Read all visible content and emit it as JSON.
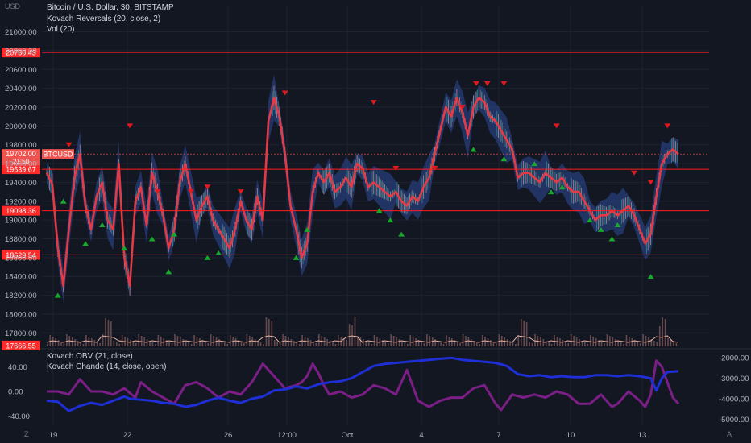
{
  "chart_data": {
    "type": "line",
    "left_axis_unit": "USD",
    "legend": {
      "symbol_line": "Bitcoin / U.S. Dollar, 30, BITSTAMP",
      "indicator_1": "Kovach Reversals (20, close, 2)",
      "indicator_2": "Vol (20)",
      "osc_1": "Kovach OBV (21, close)",
      "osc_2": "Kovach Chande (14, close, open)"
    },
    "x_axis": {
      "tick_labels": [
        "19",
        "22",
        "26",
        "12:00",
        "Oct",
        "4",
        "7",
        "10",
        "13"
      ],
      "corner_left": "Z",
      "corner_right": "A"
    },
    "price_axis": {
      "ticks": [
        21000,
        20800,
        20600,
        20400,
        20200,
        20000,
        19800,
        19600,
        19400,
        19200,
        19000,
        18800,
        18600,
        18400,
        18200,
        18000,
        17800
      ],
      "tick_labels": [
        "21000.00",
        "20800.00",
        "20600.00",
        "20400.00",
        "20200.00",
        "20000.00",
        "19800.00",
        "19600.00",
        "19400.00",
        "19200.00",
        "19000.00",
        "18800.00",
        "18600.00",
        "18400.00",
        "18200.00",
        "18000.00",
        "17800.00"
      ],
      "ylim": [
        17640,
        21270
      ]
    },
    "horizontal_levels": [
      {
        "value": 20780.43,
        "label": "20780.43"
      },
      {
        "value": 19539.67,
        "label": "19539.67"
      },
      {
        "value": 19098.36,
        "label": "19098.36"
      },
      {
        "value": 18629.54,
        "label": "18629.54"
      }
    ],
    "bottom_level": {
      "value": 17666.55,
      "label": "17666.55"
    },
    "last_price": {
      "value": 19702.0,
      "label": "19702.00",
      "ticker": "BTCUSD",
      "countdown": "21:50"
    },
    "price_path": [
      [
        0,
        19500
      ],
      [
        2,
        19380
      ],
      [
        4,
        18700
      ],
      [
        6,
        18300
      ],
      [
        8,
        18900
      ],
      [
        10,
        19450
      ],
      [
        12,
        19700
      ],
      [
        14,
        19150
      ],
      [
        16,
        18900
      ],
      [
        18,
        19250
      ],
      [
        20,
        19400
      ],
      [
        22,
        19000
      ],
      [
        24,
        18900
      ],
      [
        26,
        19600
      ],
      [
        28,
        18600
      ],
      [
        30,
        18300
      ],
      [
        32,
        19200
      ],
      [
        34,
        19350
      ],
      [
        36,
        18950
      ],
      [
        38,
        19500
      ],
      [
        40,
        19300
      ],
      [
        42,
        19050
      ],
      [
        44,
        18700
      ],
      [
        46,
        18900
      ],
      [
        48,
        19400
      ],
      [
        50,
        19600
      ],
      [
        52,
        19300
      ],
      [
        54,
        19000
      ],
      [
        56,
        19150
      ],
      [
        58,
        19250
      ],
      [
        60,
        19000
      ],
      [
        62,
        18900
      ],
      [
        64,
        18800
      ],
      [
        66,
        18700
      ],
      [
        68,
        18900
      ],
      [
        70,
        19200
      ],
      [
        72,
        19000
      ],
      [
        74,
        18900
      ],
      [
        76,
        19250
      ],
      [
        78,
        19000
      ],
      [
        80,
        20050
      ],
      [
        82,
        20300
      ],
      [
        84,
        20100
      ],
      [
        86,
        19700
      ],
      [
        88,
        19150
      ],
      [
        90,
        18900
      ],
      [
        92,
        18600
      ],
      [
        94,
        18750
      ],
      [
        96,
        19300
      ],
      [
        98,
        19500
      ],
      [
        100,
        19400
      ],
      [
        102,
        19500
      ],
      [
        104,
        19300
      ],
      [
        106,
        19350
      ],
      [
        108,
        19450
      ],
      [
        110,
        19350
      ],
      [
        112,
        19600
      ],
      [
        114,
        19550
      ],
      [
        116,
        19350
      ],
      [
        118,
        19400
      ],
      [
        120,
        19350
      ],
      [
        122,
        19300
      ],
      [
        124,
        19250
      ],
      [
        126,
        19300
      ],
      [
        128,
        19200
      ],
      [
        130,
        19150
      ],
      [
        132,
        19250
      ],
      [
        134,
        19200
      ],
      [
        136,
        19350
      ],
      [
        138,
        19450
      ],
      [
        140,
        19700
      ],
      [
        142,
        19950
      ],
      [
        144,
        20200
      ],
      [
        146,
        20100
      ],
      [
        148,
        20300
      ],
      [
        150,
        20150
      ],
      [
        152,
        19900
      ],
      [
        154,
        20200
      ],
      [
        156,
        20300
      ],
      [
        158,
        20250
      ],
      [
        160,
        20100
      ],
      [
        162,
        20050
      ],
      [
        164,
        19950
      ],
      [
        166,
        19850
      ],
      [
        168,
        19750
      ],
      [
        170,
        19450
      ],
      [
        172,
        19500
      ],
      [
        174,
        19500
      ],
      [
        176,
        19450
      ],
      [
        178,
        19400
      ],
      [
        180,
        19500
      ],
      [
        182,
        19450
      ],
      [
        184,
        19400
      ],
      [
        186,
        19450
      ],
      [
        188,
        19350
      ],
      [
        190,
        19300
      ],
      [
        192,
        19300
      ],
      [
        194,
        19200
      ],
      [
        196,
        19100
      ],
      [
        198,
        19000
      ],
      [
        200,
        19050
      ],
      [
        202,
        19050
      ],
      [
        204,
        19100
      ],
      [
        206,
        19050
      ],
      [
        208,
        19100
      ],
      [
        210,
        19150
      ],
      [
        212,
        19050
      ],
      [
        214,
        18900
      ],
      [
        216,
        18750
      ],
      [
        218,
        18850
      ],
      [
        220,
        19250
      ],
      [
        222,
        19600
      ],
      [
        224,
        19700
      ],
      [
        226,
        19750
      ],
      [
        228,
        19700
      ]
    ],
    "obv_path": [
      [
        0,
        -4100
      ],
      [
        4,
        -4150
      ],
      [
        8,
        -4600
      ],
      [
        12,
        -4350
      ],
      [
        16,
        -4200
      ],
      [
        20,
        -4300
      ],
      [
        24,
        -4100
      ],
      [
        28,
        -3900
      ],
      [
        30,
        -4000
      ],
      [
        34,
        -4050
      ],
      [
        38,
        -4100
      ],
      [
        42,
        -4200
      ],
      [
        46,
        -4250
      ],
      [
        50,
        -4400
      ],
      [
        54,
        -4300
      ],
      [
        58,
        -4100
      ],
      [
        62,
        -3950
      ],
      [
        66,
        -4100
      ],
      [
        70,
        -4200
      ],
      [
        74,
        -4000
      ],
      [
        78,
        -3900
      ],
      [
        82,
        -3600
      ],
      [
        86,
        -3550
      ],
      [
        90,
        -3400
      ],
      [
        94,
        -3500
      ],
      [
        98,
        -3300
      ],
      [
        102,
        -3200
      ],
      [
        106,
        -3150
      ],
      [
        110,
        -3000
      ],
      [
        114,
        -2700
      ],
      [
        118,
        -2400
      ],
      [
        122,
        -2300
      ],
      [
        126,
        -2250
      ],
      [
        130,
        -2200
      ],
      [
        134,
        -2150
      ],
      [
        138,
        -2100
      ],
      [
        142,
        -2050
      ],
      [
        146,
        -2000
      ],
      [
        150,
        -2100
      ],
      [
        154,
        -2150
      ],
      [
        158,
        -2200
      ],
      [
        162,
        -2250
      ],
      [
        166,
        -2400
      ],
      [
        170,
        -2800
      ],
      [
        174,
        -2900
      ],
      [
        178,
        -2850
      ],
      [
        182,
        -2950
      ],
      [
        186,
        -2900
      ],
      [
        190,
        -2950
      ],
      [
        194,
        -2950
      ],
      [
        198,
        -2850
      ],
      [
        202,
        -2850
      ],
      [
        206,
        -2900
      ],
      [
        210,
        -2850
      ],
      [
        214,
        -2900
      ],
      [
        218,
        -3000
      ],
      [
        220,
        -3600
      ],
      [
        222,
        -3000
      ],
      [
        224,
        -2700
      ],
      [
        228,
        -2650
      ]
    ],
    "chande_path": [
      [
        0,
        0
      ],
      [
        4,
        0
      ],
      [
        8,
        -5
      ],
      [
        12,
        20
      ],
      [
        16,
        0
      ],
      [
        20,
        0
      ],
      [
        24,
        -5
      ],
      [
        28,
        5
      ],
      [
        32,
        -10
      ],
      [
        34,
        15
      ],
      [
        38,
        0
      ],
      [
        42,
        -10
      ],
      [
        46,
        -20
      ],
      [
        50,
        10
      ],
      [
        54,
        15
      ],
      [
        58,
        5
      ],
      [
        62,
        -10
      ],
      [
        66,
        0
      ],
      [
        70,
        -5
      ],
      [
        74,
        15
      ],
      [
        78,
        45
      ],
      [
        82,
        25
      ],
      [
        86,
        5
      ],
      [
        90,
        10
      ],
      [
        92,
        15
      ],
      [
        94,
        25
      ],
      [
        96,
        45
      ],
      [
        98,
        30
      ],
      [
        100,
        10
      ],
      [
        102,
        -5
      ],
      [
        106,
        0
      ],
      [
        110,
        -10
      ],
      [
        114,
        -5
      ],
      [
        118,
        10
      ],
      [
        122,
        5
      ],
      [
        126,
        -5
      ],
      [
        130,
        35
      ],
      [
        134,
        -15
      ],
      [
        138,
        -25
      ],
      [
        142,
        -15
      ],
      [
        146,
        -10
      ],
      [
        150,
        -10
      ],
      [
        154,
        5
      ],
      [
        158,
        10
      ],
      [
        162,
        -20
      ],
      [
        164,
        -30
      ],
      [
        168,
        -5
      ],
      [
        172,
        -10
      ],
      [
        176,
        -5
      ],
      [
        180,
        -10
      ],
      [
        184,
        0
      ],
      [
        188,
        -5
      ],
      [
        192,
        -20
      ],
      [
        196,
        -20
      ],
      [
        200,
        -5
      ],
      [
        204,
        -25
      ],
      [
        206,
        -20
      ],
      [
        210,
        0
      ],
      [
        214,
        -15
      ],
      [
        216,
        -25
      ],
      [
        218,
        -5
      ],
      [
        220,
        50
      ],
      [
        222,
        40
      ],
      [
        224,
        15
      ],
      [
        226,
        -10
      ],
      [
        228,
        -20
      ]
    ],
    "osc_left_axis": {
      "ticks": [
        40,
        0,
        -40
      ],
      "tick_labels": [
        "40.00",
        "0.00",
        "-40.00"
      ],
      "ylim": [
        -55,
        68
      ]
    },
    "osc_right_axis": {
      "ticks": [
        -2000,
        -3000,
        -4000,
        -5000
      ],
      "tick_labels": [
        "-2000.00",
        "-3000.00",
        "-4000.00",
        "-5000.00"
      ],
      "ylim": [
        -5300,
        -1600
      ]
    },
    "sell_signals": [
      [
        8,
        19800
      ],
      [
        30,
        20000
      ],
      [
        40,
        19300
      ],
      [
        52,
        19300
      ],
      [
        58,
        19350
      ],
      [
        70,
        19300
      ],
      [
        86,
        20350
      ],
      [
        118,
        20250
      ],
      [
        126,
        19550
      ],
      [
        140,
        19550
      ],
      [
        150,
        20200
      ],
      [
        155,
        20450
      ],
      [
        159,
        20450
      ],
      [
        165,
        20450
      ],
      [
        184,
        20000
      ],
      [
        212,
        19500
      ],
      [
        218,
        19400
      ],
      [
        224,
        20000
      ]
    ],
    "buy_signals": [
      [
        4,
        18200
      ],
      [
        6,
        19200
      ],
      [
        14,
        18750
      ],
      [
        20,
        18950
      ],
      [
        28,
        18700
      ],
      [
        38,
        18800
      ],
      [
        44,
        18450
      ],
      [
        46,
        18850
      ],
      [
        58,
        18600
      ],
      [
        62,
        18650
      ],
      [
        90,
        18600
      ],
      [
        94,
        18900
      ],
      [
        120,
        19100
      ],
      [
        124,
        19000
      ],
      [
        128,
        18850
      ],
      [
        154,
        19750
      ],
      [
        165,
        19650
      ],
      [
        176,
        19600
      ],
      [
        182,
        19300
      ],
      [
        186,
        19350
      ],
      [
        196,
        19000
      ],
      [
        200,
        18900
      ],
      [
        204,
        18800
      ],
      [
        206,
        18950
      ],
      [
        218,
        18400
      ]
    ],
    "colors": {
      "background": "#131722",
      "grid": "#1f2230",
      "price": "#a7adb7",
      "ma": "#e63946",
      "band": "#2c4a99",
      "level_line": "#ff1e1e",
      "level_label_bg": "#ff2b2b",
      "last_price_bg": "#ef5350",
      "sell": "#e0191f",
      "buy": "#17a82c",
      "volume": "#a06a6a",
      "obv": "#1e2fd6",
      "chande": "#7b1e86",
      "axis_text": "#b2b5be"
    }
  }
}
